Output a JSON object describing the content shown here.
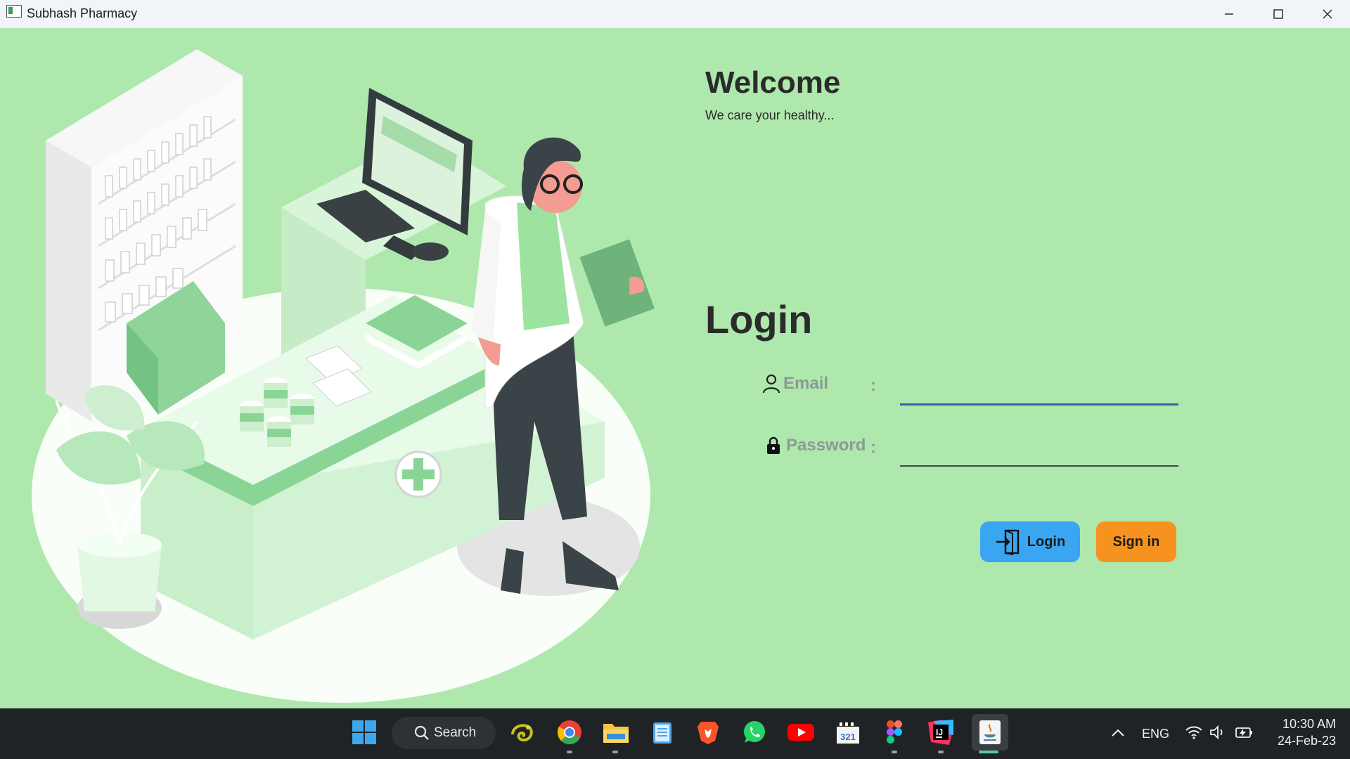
{
  "window": {
    "title": "Subhash Pharmacy",
    "controls": [
      "minimize",
      "maximize",
      "close"
    ]
  },
  "welcome": {
    "title": "Welcome",
    "subtitle": "We care your healthy..."
  },
  "login": {
    "title": "Login",
    "email_label": "Email",
    "password_label": "Password",
    "colon": ":",
    "email_value": "",
    "password_value": "",
    "login_button": "Login",
    "signin_button": "Sign in"
  },
  "colors": {
    "background": "#afe8ad",
    "login_button": "#3aa6f1",
    "signin_button": "#f6921e",
    "taskbar": "#202326"
  },
  "taskbar": {
    "search_label": "Search",
    "apps": [
      "windows-start-icon",
      "chameleon-app-icon",
      "chrome-icon",
      "file-explorer-icon",
      "notepad-icon",
      "brave-icon",
      "whatsapp-icon",
      "youtube-icon",
      "clipchamp-icon",
      "figma-icon",
      "intellij-icon",
      "java-app-icon"
    ],
    "language": "ENG",
    "time": "10:30 AM",
    "date": "24-Feb-23"
  }
}
